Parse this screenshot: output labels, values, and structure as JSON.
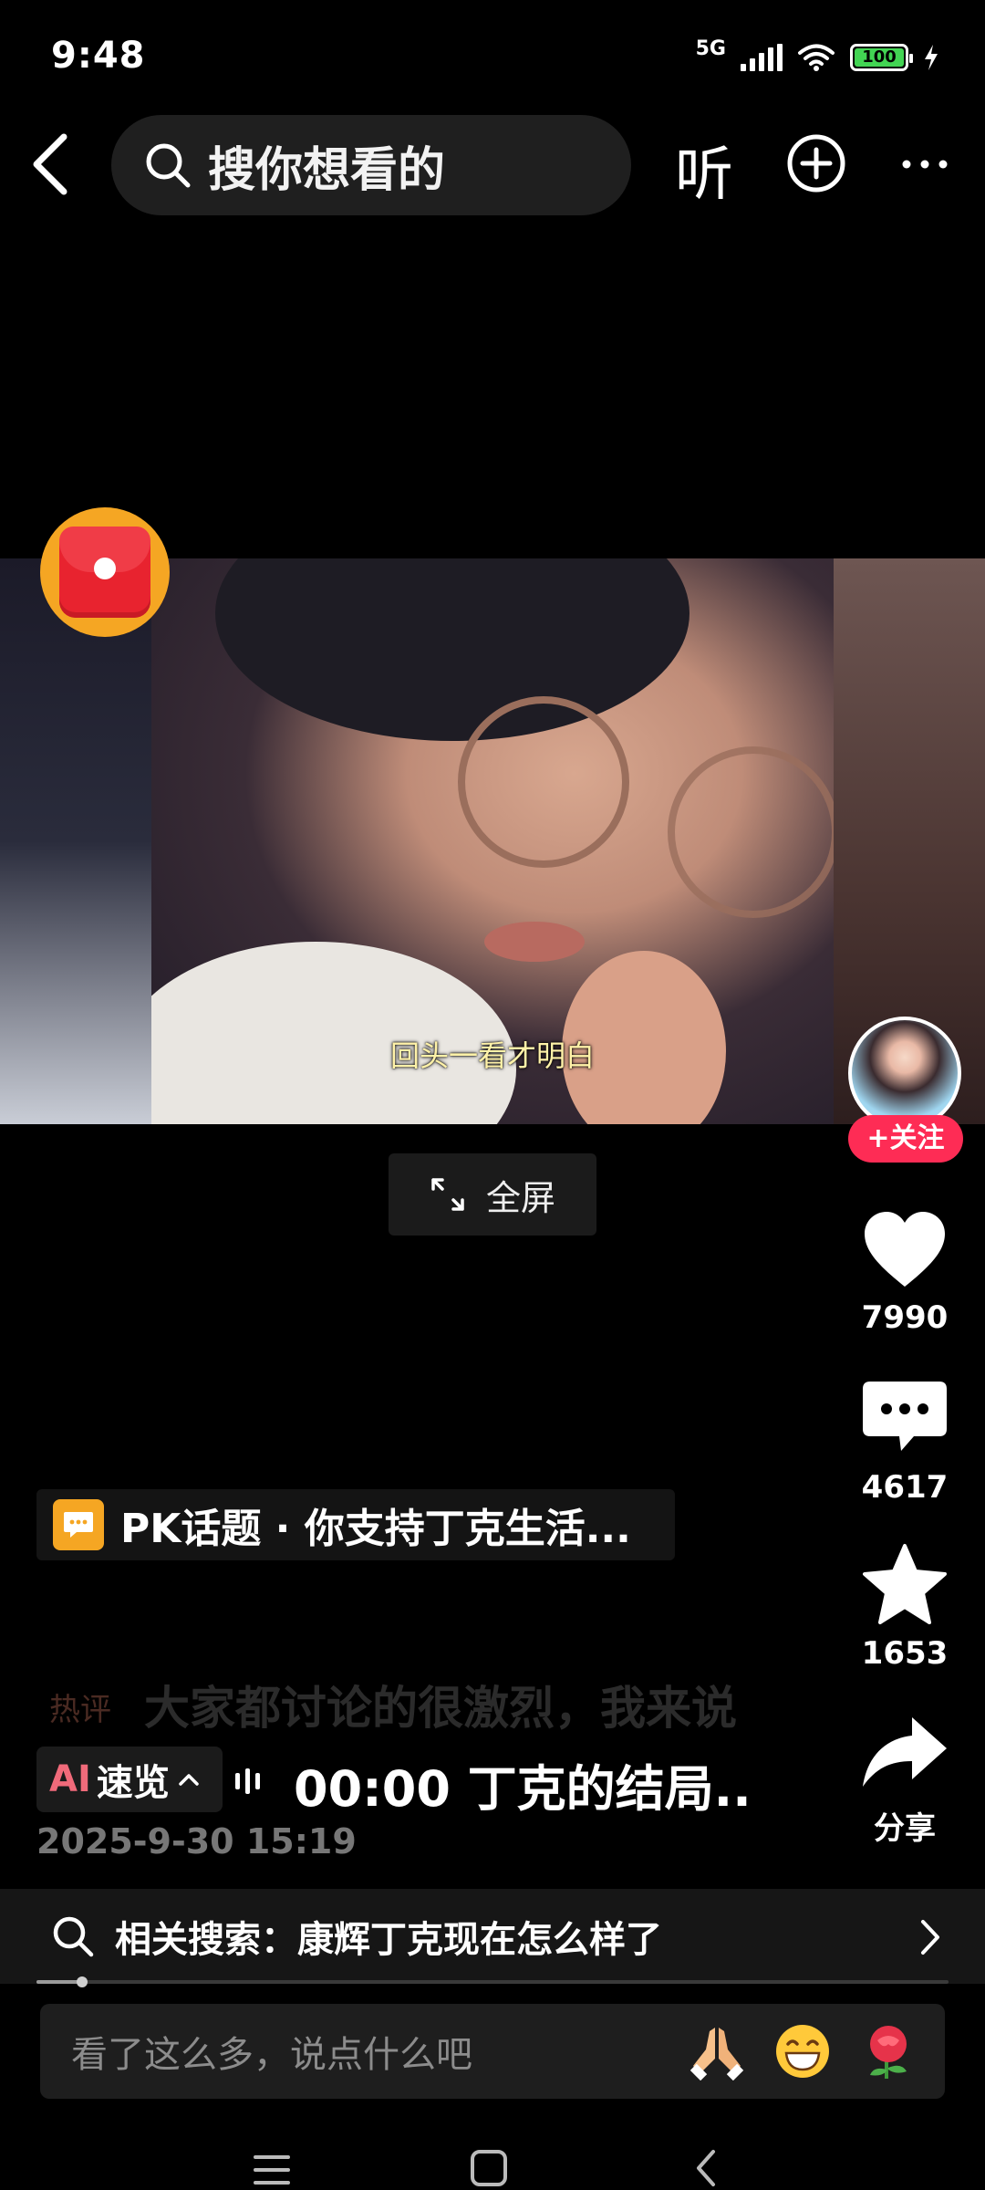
{
  "status_bar": {
    "time": "9:48",
    "network": "5G",
    "battery": "100"
  },
  "top_bar": {
    "search_placeholder": "搜你想看的",
    "listen_label": "听"
  },
  "video": {
    "subtitle": "回头一看才明白",
    "fullscreen_label": "全屏"
  },
  "actions": {
    "follow_label": "+关注",
    "likes": "7990",
    "comments": "4617",
    "favorites": "1653",
    "share_label": "分享"
  },
  "topic": {
    "text": "PK话题 · 你支持丁克生活..."
  },
  "hot_comment": {
    "tag": "热评",
    "text": "大家都讨论的很激烈，我来说"
  },
  "summary": {
    "ai_logo": "AI",
    "ai_label": "速览",
    "text": "00:00 丁克的结局.."
  },
  "post": {
    "date": "2025-9-30 15:19"
  },
  "related_search": {
    "text": "相关搜索：康辉丁克现在怎么样了"
  },
  "playback": {
    "progress": 0.05
  },
  "comment_input": {
    "placeholder": "看了这么多，说点什么吧"
  },
  "colors": {
    "accent": "#fe2c55",
    "topic_icon": "#f5a623",
    "redpacket": "#e8232f"
  }
}
